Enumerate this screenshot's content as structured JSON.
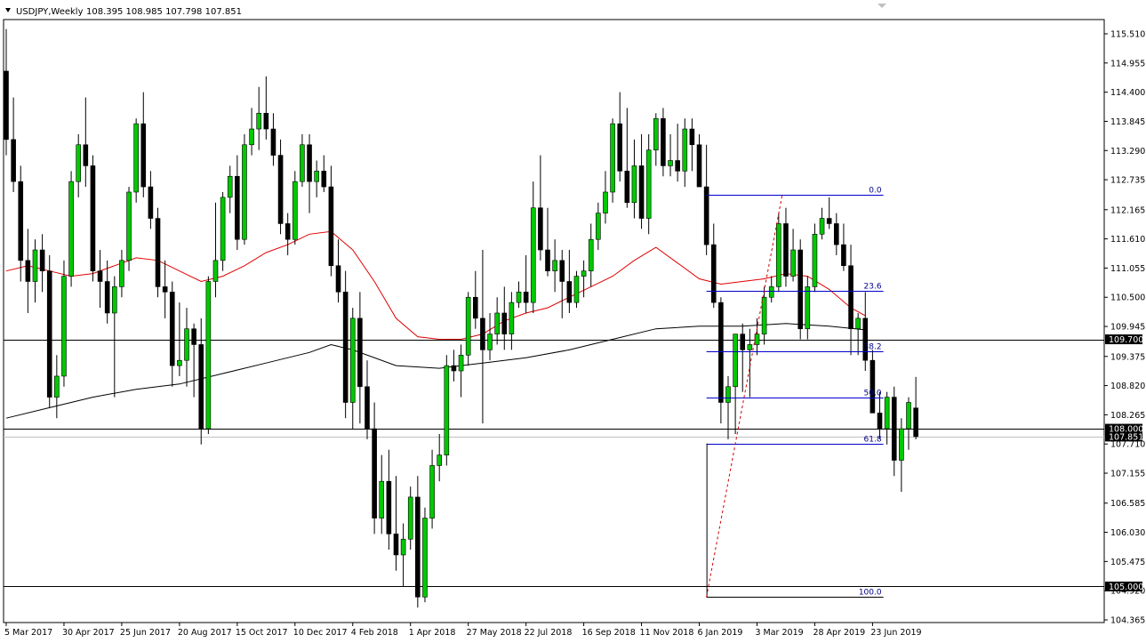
{
  "header": {
    "symbol": "USDJPY,Weekly",
    "ohlc": "108.395 108.985 107.798 107.851"
  },
  "colors": {
    "background": "#ffffff",
    "bull": "#00c800",
    "bear": "#000000",
    "wick": "#000000",
    "ma_fast": "#e00000",
    "ma_slow": "#000000",
    "fib": "#0000cc",
    "hline": "#000000",
    "badge": "#000000"
  },
  "chart_data": {
    "type": "candlestick",
    "title": "USDJPY,Weekly",
    "ylim": [
      104.1,
      116.1
    ],
    "y_ticks": [
      "115.510",
      "114.955",
      "114.400",
      "113.845",
      "113.290",
      "112.735",
      "112.165",
      "111.610",
      "111.055",
      "110.500",
      "109.945",
      "109.375",
      "108.820",
      "108.265",
      "107.710",
      "107.155",
      "106.585",
      "106.030",
      "105.475",
      "104.920",
      "104.365"
    ],
    "y_tick_values": [
      115.51,
      114.955,
      114.4,
      113.845,
      113.29,
      112.735,
      112.165,
      111.61,
      111.055,
      110.5,
      109.945,
      109.375,
      108.82,
      108.265,
      107.71,
      107.155,
      106.585,
      106.03,
      105.475,
      104.92,
      104.365
    ],
    "x_labels": [
      "5 Mar 2017",
      "30 Apr 2017",
      "25 Jun 2017",
      "20 Aug 2017",
      "15 Oct 2017",
      "10 Dec 2017",
      "4 Feb 2018",
      "1 Apr 2018",
      "27 May 2018",
      "22 Jul 2018",
      "16 Sep 2018",
      "11 Nov 2018",
      "6 Jan 2019",
      "3 Mar 2019",
      "28 Apr 2019",
      "23 Jun 2019"
    ],
    "x_label_index": [
      0,
      8,
      16,
      24,
      32,
      40,
      48,
      56,
      64,
      72,
      80,
      88,
      96,
      104,
      112,
      120
    ],
    "candles": [
      {
        "o": 114.8,
        "h": 115.6,
        "l": 113.2,
        "c": 113.5
      },
      {
        "o": 113.5,
        "h": 114.3,
        "l": 112.5,
        "c": 112.7
      },
      {
        "o": 112.7,
        "h": 113.0,
        "l": 110.8,
        "c": 111.2
      },
      {
        "o": 111.2,
        "h": 111.8,
        "l": 110.2,
        "c": 110.8
      },
      {
        "o": 110.8,
        "h": 111.6,
        "l": 110.4,
        "c": 111.4
      },
      {
        "o": 111.4,
        "h": 111.7,
        "l": 110.6,
        "c": 111.0
      },
      {
        "o": 111.0,
        "h": 111.3,
        "l": 108.4,
        "c": 108.6
      },
      {
        "o": 108.6,
        "h": 109.4,
        "l": 108.2,
        "c": 109.0
      },
      {
        "o": 109.0,
        "h": 111.2,
        "l": 108.8,
        "c": 110.9
      },
      {
        "o": 110.9,
        "h": 112.9,
        "l": 110.7,
        "c": 112.7
      },
      {
        "o": 112.7,
        "h": 113.6,
        "l": 112.4,
        "c": 113.4
      },
      {
        "o": 113.4,
        "h": 114.3,
        "l": 112.6,
        "c": 113.0
      },
      {
        "o": 113.0,
        "h": 113.2,
        "l": 110.8,
        "c": 111.0
      },
      {
        "o": 111.0,
        "h": 111.4,
        "l": 110.3,
        "c": 110.8
      },
      {
        "o": 110.8,
        "h": 111.2,
        "l": 110.0,
        "c": 110.2
      },
      {
        "o": 110.2,
        "h": 110.9,
        "l": 108.6,
        "c": 110.7
      },
      {
        "o": 110.7,
        "h": 111.4,
        "l": 110.5,
        "c": 111.2
      },
      {
        "o": 111.2,
        "h": 112.6,
        "l": 111.0,
        "c": 112.5
      },
      {
        "o": 112.5,
        "h": 113.9,
        "l": 112.3,
        "c": 113.8
      },
      {
        "o": 113.8,
        "h": 114.4,
        "l": 112.4,
        "c": 112.6
      },
      {
        "o": 112.6,
        "h": 112.9,
        "l": 111.8,
        "c": 112.0
      },
      {
        "o": 112.0,
        "h": 112.2,
        "l": 110.5,
        "c": 110.7
      },
      {
        "o": 110.7,
        "h": 111.2,
        "l": 110.1,
        "c": 110.6
      },
      {
        "o": 110.6,
        "h": 110.8,
        "l": 108.8,
        "c": 109.2
      },
      {
        "o": 109.2,
        "h": 110.4,
        "l": 109.0,
        "c": 109.3
      },
      {
        "o": 109.3,
        "h": 110.3,
        "l": 108.8,
        "c": 109.9
      },
      {
        "o": 109.9,
        "h": 110.0,
        "l": 108.6,
        "c": 109.6
      },
      {
        "o": 109.6,
        "h": 110.1,
        "l": 107.7,
        "c": 108.0
      },
      {
        "o": 108.0,
        "h": 110.9,
        "l": 107.9,
        "c": 110.8
      },
      {
        "o": 110.8,
        "h": 112.3,
        "l": 110.5,
        "c": 111.2
      },
      {
        "o": 111.2,
        "h": 112.5,
        "l": 111.0,
        "c": 112.4
      },
      {
        "o": 112.4,
        "h": 113.0,
        "l": 112.1,
        "c": 112.8
      },
      {
        "o": 112.8,
        "h": 113.2,
        "l": 111.4,
        "c": 111.6
      },
      {
        "o": 111.6,
        "h": 113.6,
        "l": 111.5,
        "c": 113.4
      },
      {
        "o": 113.4,
        "h": 114.1,
        "l": 113.2,
        "c": 113.7
      },
      {
        "o": 113.7,
        "h": 114.5,
        "l": 113.3,
        "c": 114.0
      },
      {
        "o": 114.0,
        "h": 114.7,
        "l": 113.5,
        "c": 113.7
      },
      {
        "o": 113.7,
        "h": 114.0,
        "l": 113.0,
        "c": 113.2
      },
      {
        "o": 113.2,
        "h": 113.5,
        "l": 111.7,
        "c": 111.9
      },
      {
        "o": 111.9,
        "h": 112.1,
        "l": 111.3,
        "c": 111.6
      },
      {
        "o": 111.6,
        "h": 112.9,
        "l": 111.5,
        "c": 112.7
      },
      {
        "o": 112.7,
        "h": 113.6,
        "l": 112.6,
        "c": 113.4
      },
      {
        "o": 113.4,
        "h": 113.6,
        "l": 112.1,
        "c": 112.7
      },
      {
        "o": 112.7,
        "h": 113.1,
        "l": 112.4,
        "c": 112.9
      },
      {
        "o": 112.9,
        "h": 113.2,
        "l": 112.5,
        "c": 112.6
      },
      {
        "o": 112.6,
        "h": 113.0,
        "l": 110.9,
        "c": 111.1
      },
      {
        "o": 111.1,
        "h": 111.6,
        "l": 110.4,
        "c": 110.6
      },
      {
        "o": 110.6,
        "h": 111.0,
        "l": 108.2,
        "c": 108.5
      },
      {
        "o": 108.5,
        "h": 110.3,
        "l": 108.0,
        "c": 110.1
      },
      {
        "o": 110.1,
        "h": 110.6,
        "l": 108.1,
        "c": 108.8
      },
      {
        "o": 108.8,
        "h": 109.3,
        "l": 107.8,
        "c": 108.0
      },
      {
        "o": 108.0,
        "h": 108.5,
        "l": 106.0,
        "c": 106.3
      },
      {
        "o": 106.3,
        "h": 107.5,
        "l": 106.0,
        "c": 107.0
      },
      {
        "o": 107.0,
        "h": 107.6,
        "l": 105.7,
        "c": 106.0
      },
      {
        "o": 106.0,
        "h": 107.1,
        "l": 105.3,
        "c": 105.6
      },
      {
        "o": 105.6,
        "h": 106.2,
        "l": 105.0,
        "c": 105.9
      },
      {
        "o": 105.9,
        "h": 106.9,
        "l": 105.7,
        "c": 106.7
      },
      {
        "o": 106.7,
        "h": 107.1,
        "l": 104.6,
        "c": 104.8
      },
      {
        "o": 104.8,
        "h": 106.5,
        "l": 104.7,
        "c": 106.3
      },
      {
        "o": 106.3,
        "h": 107.6,
        "l": 106.1,
        "c": 107.3
      },
      {
        "o": 107.3,
        "h": 107.9,
        "l": 107.0,
        "c": 107.5
      },
      {
        "o": 107.5,
        "h": 109.4,
        "l": 107.3,
        "c": 109.2
      },
      {
        "o": 109.2,
        "h": 109.5,
        "l": 108.9,
        "c": 109.1
      },
      {
        "o": 109.1,
        "h": 109.6,
        "l": 108.6,
        "c": 109.4
      },
      {
        "o": 109.4,
        "h": 110.6,
        "l": 109.2,
        "c": 110.5
      },
      {
        "o": 110.5,
        "h": 111.0,
        "l": 109.9,
        "c": 110.1
      },
      {
        "o": 110.1,
        "h": 111.4,
        "l": 108.1,
        "c": 109.5
      },
      {
        "o": 109.5,
        "h": 110.2,
        "l": 109.3,
        "c": 109.8
      },
      {
        "o": 109.8,
        "h": 110.5,
        "l": 109.6,
        "c": 110.2
      },
      {
        "o": 110.2,
        "h": 110.7,
        "l": 109.5,
        "c": 109.8
      },
      {
        "o": 109.8,
        "h": 110.6,
        "l": 109.5,
        "c": 110.4
      },
      {
        "o": 110.4,
        "h": 110.8,
        "l": 110.3,
        "c": 110.6
      },
      {
        "o": 110.6,
        "h": 111.3,
        "l": 110.2,
        "c": 110.4
      },
      {
        "o": 110.4,
        "h": 112.7,
        "l": 110.2,
        "c": 112.2
      },
      {
        "o": 112.2,
        "h": 113.2,
        "l": 111.2,
        "c": 111.4
      },
      {
        "o": 111.4,
        "h": 112.2,
        "l": 110.9,
        "c": 111.0
      },
      {
        "o": 111.0,
        "h": 111.6,
        "l": 110.6,
        "c": 111.2
      },
      {
        "o": 111.2,
        "h": 111.4,
        "l": 110.1,
        "c": 110.8
      },
      {
        "o": 110.8,
        "h": 111.4,
        "l": 110.2,
        "c": 110.4
      },
      {
        "o": 110.4,
        "h": 111.0,
        "l": 110.3,
        "c": 110.9
      },
      {
        "o": 110.9,
        "h": 111.2,
        "l": 110.5,
        "c": 111.0
      },
      {
        "o": 111.0,
        "h": 111.9,
        "l": 110.7,
        "c": 111.6
      },
      {
        "o": 111.6,
        "h": 112.3,
        "l": 111.4,
        "c": 112.1
      },
      {
        "o": 112.1,
        "h": 112.9,
        "l": 111.9,
        "c": 112.5
      },
      {
        "o": 112.5,
        "h": 113.9,
        "l": 112.3,
        "c": 113.8
      },
      {
        "o": 113.8,
        "h": 114.4,
        "l": 112.7,
        "c": 112.9
      },
      {
        "o": 112.9,
        "h": 114.1,
        "l": 112.2,
        "c": 112.3
      },
      {
        "o": 112.3,
        "h": 113.5,
        "l": 112.0,
        "c": 113.0
      },
      {
        "o": 113.0,
        "h": 113.6,
        "l": 111.8,
        "c": 112.0
      },
      {
        "o": 112.0,
        "h": 113.6,
        "l": 111.7,
        "c": 113.3
      },
      {
        "o": 113.3,
        "h": 114.0,
        "l": 113.0,
        "c": 113.9
      },
      {
        "o": 113.9,
        "h": 114.1,
        "l": 112.8,
        "c": 113.0
      },
      {
        "o": 113.0,
        "h": 113.6,
        "l": 112.8,
        "c": 113.1
      },
      {
        "o": 113.1,
        "h": 113.8,
        "l": 112.7,
        "c": 112.9
      },
      {
        "o": 112.9,
        "h": 113.9,
        "l": 112.6,
        "c": 113.7
      },
      {
        "o": 113.7,
        "h": 113.9,
        "l": 112.9,
        "c": 113.4
      },
      {
        "o": 113.4,
        "h": 113.6,
        "l": 112.6,
        "c": 112.6
      },
      {
        "o": 112.6,
        "h": 113.4,
        "l": 111.3,
        "c": 111.5
      },
      {
        "o": 111.5,
        "h": 111.9,
        "l": 110.3,
        "c": 110.4
      },
      {
        "o": 110.4,
        "h": 110.5,
        "l": 108.1,
        "c": 108.5
      },
      {
        "o": 108.5,
        "h": 109.0,
        "l": 107.8,
        "c": 108.8
      },
      {
        "o": 108.8,
        "h": 109.8,
        "l": 107.9,
        "c": 109.8
      },
      {
        "o": 109.8,
        "h": 110.0,
        "l": 108.7,
        "c": 109.5
      },
      {
        "o": 109.5,
        "h": 109.9,
        "l": 108.6,
        "c": 109.6
      },
      {
        "o": 109.6,
        "h": 110.1,
        "l": 109.4,
        "c": 109.8
      },
      {
        "o": 109.8,
        "h": 110.7,
        "l": 109.6,
        "c": 110.5
      },
      {
        "o": 110.5,
        "h": 110.9,
        "l": 110.4,
        "c": 110.7
      },
      {
        "o": 110.7,
        "h": 112.1,
        "l": 110.6,
        "c": 111.9
      },
      {
        "o": 111.9,
        "h": 112.2,
        "l": 110.7,
        "c": 110.9
      },
      {
        "o": 110.9,
        "h": 111.8,
        "l": 110.8,
        "c": 111.4
      },
      {
        "o": 111.4,
        "h": 111.6,
        "l": 109.7,
        "c": 109.9
      },
      {
        "o": 109.9,
        "h": 110.9,
        "l": 109.7,
        "c": 110.7
      },
      {
        "o": 110.7,
        "h": 111.9,
        "l": 110.6,
        "c": 111.7
      },
      {
        "o": 111.7,
        "h": 112.2,
        "l": 111.6,
        "c": 112.0
      },
      {
        "o": 112.0,
        "h": 112.4,
        "l": 111.8,
        "c": 111.9
      },
      {
        "o": 111.9,
        "h": 112.1,
        "l": 111.3,
        "c": 111.5
      },
      {
        "o": 111.5,
        "h": 111.9,
        "l": 111.0,
        "c": 111.1
      },
      {
        "o": 111.1,
        "h": 111.5,
        "l": 109.4,
        "c": 109.9
      },
      {
        "o": 109.9,
        "h": 110.2,
        "l": 109.4,
        "c": 110.1
      },
      {
        "o": 110.1,
        "h": 110.6,
        "l": 109.1,
        "c": 109.3
      },
      {
        "o": 109.3,
        "h": 109.5,
        "l": 108.3,
        "c": 108.3
      },
      {
        "o": 108.3,
        "h": 108.7,
        "l": 107.8,
        "c": 108.0
      },
      {
        "o": 108.0,
        "h": 108.7,
        "l": 107.7,
        "c": 108.6
      },
      {
        "o": 108.6,
        "h": 108.8,
        "l": 107.1,
        "c": 107.4
      },
      {
        "o": 107.4,
        "h": 108.2,
        "l": 106.8,
        "c": 108.0
      },
      {
        "o": 108.0,
        "h": 108.6,
        "l": 107.6,
        "c": 108.5
      },
      {
        "o": 108.395,
        "h": 108.985,
        "l": 107.798,
        "c": 107.851
      }
    ],
    "series": [
      {
        "kind": "ma",
        "color_key": "ma_fast",
        "values": [
          {
            "i": 0,
            "v": 111.0
          },
          {
            "i": 3,
            "v": 111.1
          },
          {
            "i": 6,
            "v": 111.0
          },
          {
            "i": 9,
            "v": 110.9
          },
          {
            "i": 12,
            "v": 110.95
          },
          {
            "i": 15,
            "v": 111.1
          },
          {
            "i": 18,
            "v": 111.25
          },
          {
            "i": 21,
            "v": 111.2
          },
          {
            "i": 24,
            "v": 111.0
          },
          {
            "i": 27,
            "v": 110.8
          },
          {
            "i": 30,
            "v": 110.9
          },
          {
            "i": 33,
            "v": 111.1
          },
          {
            "i": 36,
            "v": 111.35
          },
          {
            "i": 39,
            "v": 111.5
          },
          {
            "i": 42,
            "v": 111.7
          },
          {
            "i": 45,
            "v": 111.75
          },
          {
            "i": 48,
            "v": 111.4
          },
          {
            "i": 51,
            "v": 110.8
          },
          {
            "i": 54,
            "v": 110.1
          },
          {
            "i": 57,
            "v": 109.75
          },
          {
            "i": 60,
            "v": 109.7
          },
          {
            "i": 63,
            "v": 109.7
          },
          {
            "i": 66,
            "v": 109.8
          },
          {
            "i": 69,
            "v": 110.05
          },
          {
            "i": 72,
            "v": 110.2
          },
          {
            "i": 75,
            "v": 110.3
          },
          {
            "i": 78,
            "v": 110.5
          },
          {
            "i": 81,
            "v": 110.7
          },
          {
            "i": 84,
            "v": 110.9
          },
          {
            "i": 87,
            "v": 111.2
          },
          {
            "i": 90,
            "v": 111.45
          },
          {
            "i": 93,
            "v": 111.15
          },
          {
            "i": 96,
            "v": 110.85
          },
          {
            "i": 99,
            "v": 110.75
          },
          {
            "i": 102,
            "v": 110.8
          },
          {
            "i": 105,
            "v": 110.85
          },
          {
            "i": 108,
            "v": 110.95
          },
          {
            "i": 111,
            "v": 110.9
          },
          {
            "i": 114,
            "v": 110.65
          },
          {
            "i": 117,
            "v": 110.3
          },
          {
            "i": 119,
            "v": 110.15
          }
        ]
      },
      {
        "kind": "ma",
        "color_key": "ma_slow",
        "values": [
          {
            "i": 0,
            "v": 108.2
          },
          {
            "i": 6,
            "v": 108.4
          },
          {
            "i": 12,
            "v": 108.6
          },
          {
            "i": 18,
            "v": 108.75
          },
          {
            "i": 24,
            "v": 108.85
          },
          {
            "i": 30,
            "v": 109.05
          },
          {
            "i": 36,
            "v": 109.25
          },
          {
            "i": 42,
            "v": 109.45
          },
          {
            "i": 45,
            "v": 109.6
          },
          {
            "i": 48,
            "v": 109.5
          },
          {
            "i": 54,
            "v": 109.2
          },
          {
            "i": 60,
            "v": 109.15
          },
          {
            "i": 66,
            "v": 109.25
          },
          {
            "i": 72,
            "v": 109.35
          },
          {
            "i": 78,
            "v": 109.5
          },
          {
            "i": 84,
            "v": 109.7
          },
          {
            "i": 90,
            "v": 109.9
          },
          {
            "i": 96,
            "v": 109.95
          },
          {
            "i": 102,
            "v": 109.95
          },
          {
            "i": 108,
            "v": 110.0
          },
          {
            "i": 114,
            "v": 109.95
          },
          {
            "i": 119,
            "v": 109.88
          }
        ]
      }
    ],
    "hlines": [
      {
        "value": 109.7,
        "label": "109.700"
      },
      {
        "value": 108.0,
        "label": "108.000"
      },
      {
        "value": 105.0,
        "label": "105.000"
      }
    ],
    "current_price": {
      "value": 107.851,
      "label": "107.851"
    },
    "fibonacci": {
      "start_index": 97,
      "end_index": 121.5,
      "high": 112.45,
      "low": 104.8,
      "high_index": 107,
      "low_index": 97,
      "levels": [
        {
          "label": "0.0",
          "value": 112.45
        },
        {
          "label": "23.6",
          "value": 110.62
        },
        {
          "label": "38.2",
          "value": 109.48
        },
        {
          "label": "50.0",
          "value": 108.6
        },
        {
          "label": "61.8",
          "value": 107.72
        },
        {
          "label": "100.0",
          "value": 104.8
        }
      ]
    }
  }
}
